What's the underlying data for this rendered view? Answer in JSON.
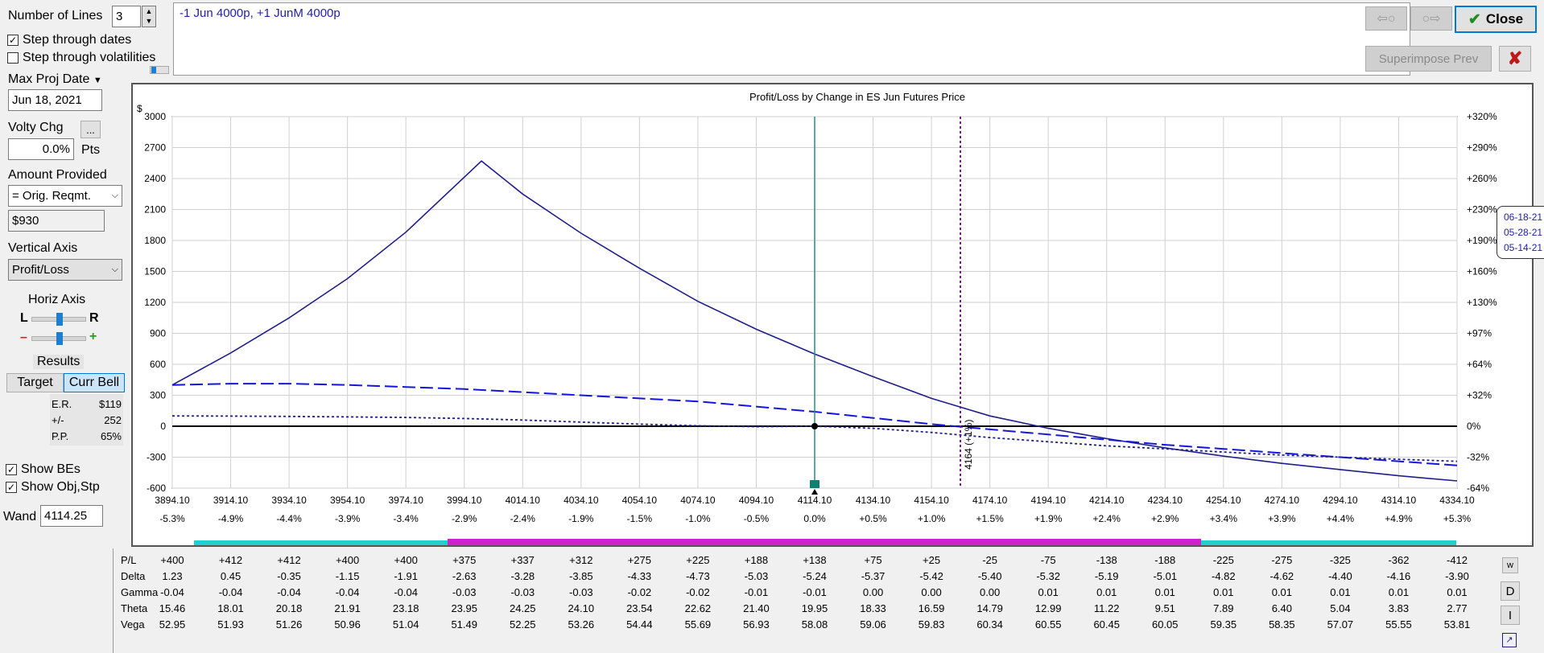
{
  "controls": {
    "number_of_lines_label": "Number of Lines",
    "number_of_lines_value": "3",
    "step_dates_label": "Step through dates",
    "step_vol_label": "Step through volatilities",
    "max_proj_label": "Max Proj Date",
    "max_proj_value": "Jun 18, 2021",
    "volty_label": "Volty Chg",
    "volty_btn": "...",
    "volty_value": "0.0%",
    "volty_unit": "Pts",
    "amount_label": "Amount Provided",
    "amount_combo": "= Orig. Reqmt.",
    "amount_value": "$930",
    "vertical_label": "Vertical Axis",
    "vertical_value": "Profit/Loss",
    "horiz_label": "Horiz Axis",
    "horiz_l": "L",
    "horiz_r": "R",
    "minus": "–",
    "plus": "+",
    "results_label": "Results",
    "target_btn": "Target",
    "currbell_btn": "Curr Bell",
    "er_label": "E.R.",
    "er_value": "$119",
    "pm_label": "+/-",
    "pm_value": "252",
    "pp_label": "P.P.",
    "pp_value": "65%",
    "show_bes": "Show BEs",
    "show_obj": "Show Obj,Stp",
    "wand_label": "Wand",
    "wand_value": "4114.25"
  },
  "editor_text": "-1 Jun 4000p, +1 JunM 4000p",
  "buttons": {
    "close": "Close",
    "superimpose": "Superimpose Prev",
    "back_arrow": "⇦○",
    "fwd_arrow": "○⇨",
    "x": "✘",
    "table_w": "w",
    "table_d": "D",
    "table_i": "I"
  },
  "colors": {
    "line_main": "#1f1f8c",
    "line_dashed": "#1515e0",
    "teal": "#2a8c8c",
    "purple": "#7a1a8c",
    "cyan_bar": "#20d0d0",
    "magenta_bar": "#d020d0"
  },
  "chart_data": {
    "type": "line",
    "title": "Profit/Loss by Change in ES Jun Futures Price",
    "ylabel": "$",
    "ylim": [
      -600,
      3000
    ],
    "y_ticks": [
      3000,
      2700,
      2400,
      2100,
      1800,
      1500,
      1200,
      900,
      600,
      300,
      0,
      -300,
      -600
    ],
    "y_ticks_right": [
      "+320%",
      "+290%",
      "+260%",
      "+230%",
      "+190%",
      "+160%",
      "+130%",
      "+97%",
      "+64%",
      "+32%",
      "0%",
      "-32%",
      "-64%"
    ],
    "xlim": [
      3894.1,
      4334.1
    ],
    "x_ticks": [
      3894.1,
      3914.1,
      3934.1,
      3954.1,
      3974.1,
      3994.1,
      4014.1,
      4034.1,
      4054.1,
      4074.1,
      4094.1,
      4114.1,
      4134.1,
      4154.1,
      4174.1,
      4194.1,
      4214.1,
      4234.1,
      4254.1,
      4274.1,
      4294.1,
      4314.1,
      4334.1
    ],
    "x_tick_labels": [
      "3894.10",
      "3914.10",
      "3934.10",
      "3954.10",
      "3974.10",
      "3994.10",
      "4014.10",
      "4034.10",
      "4054.10",
      "4074.10",
      "4094.10",
      "4114.10",
      "4134.10",
      "4154.10",
      "4174.10",
      "4194.10",
      "4214.10",
      "4234.10",
      "4254.10",
      "4274.10",
      "4294.10",
      "4314.10",
      "4334.10"
    ],
    "x_pct_labels": [
      "-5.3%",
      "-4.9%",
      "-4.4%",
      "-3.9%",
      "-3.4%",
      "-2.9%",
      "-2.4%",
      "-1.9%",
      "-1.5%",
      "-1.0%",
      "-0.5%",
      "0.0%",
      "+0.5%",
      "+1.0%",
      "+1.5%",
      "+1.9%",
      "+2.4%",
      "+2.9%",
      "+3.4%",
      "+3.9%",
      "+4.4%",
      "+4.9%",
      "+5.3%"
    ],
    "current_price": 4114.1,
    "marker_price": 4164,
    "marker_label": "4164 (+1%)",
    "series": [
      {
        "name": "06-18-21",
        "style": "solid",
        "x": [
          3894.1,
          3914.1,
          3934.1,
          3954.1,
          3974.1,
          4000,
          4014.1,
          4034.1,
          4054.1,
          4074.1,
          4094.1,
          4114.1,
          4134.1,
          4154.1,
          4174.1,
          4194.1,
          4214.1,
          4234.1,
          4254.1,
          4274.1,
          4294.1,
          4314.1,
          4334.1
        ],
        "y": [
          400,
          710,
          1050,
          1430,
          1880,
          2570,
          2250,
          1870,
          1530,
          1210,
          940,
          700,
          480,
          270,
          100,
          -20,
          -120,
          -210,
          -290,
          -360,
          -420,
          -480,
          -530
        ]
      },
      {
        "name": "05-28-21 *",
        "style": "dashed",
        "x": [
          3894.1,
          3914.1,
          3934.1,
          3954.1,
          3974.1,
          3994.1,
          4014.1,
          4034.1,
          4054.1,
          4074.1,
          4094.1,
          4114.1,
          4134.1,
          4154.1,
          4174.1,
          4194.1,
          4214.1,
          4234.1,
          4254.1,
          4274.1,
          4294.1,
          4314.1,
          4334.1
        ],
        "y": [
          400,
          412,
          412,
          400,
          380,
          360,
          330,
          300,
          270,
          240,
          190,
          140,
          80,
          20,
          -30,
          -80,
          -130,
          -180,
          -220,
          -260,
          -300,
          -340,
          -380
        ]
      },
      {
        "name": "05-14-21",
        "style": "dotted",
        "x": [
          3894.1,
          3914.1,
          3934.1,
          3954.1,
          3974.1,
          3994.1,
          4014.1,
          4034.1,
          4054.1,
          4074.1,
          4094.1,
          4114.1,
          4134.1,
          4154.1,
          4174.1,
          4194.1,
          4214.1,
          4234.1,
          4254.1,
          4274.1,
          4294.1,
          4314.1,
          4334.1
        ],
        "y": [
          100,
          98,
          95,
          90,
          85,
          75,
          60,
          40,
          20,
          5,
          -5,
          0,
          -20,
          -60,
          -110,
          -150,
          -190,
          -220,
          -250,
          -280,
          -300,
          -320,
          -340
        ]
      }
    ]
  },
  "table": {
    "rows": [
      {
        "label": "P/L",
        "values": [
          "+400",
          "+412",
          "+412",
          "+400",
          "+400",
          "+375",
          "+337",
          "+312",
          "+275",
          "+225",
          "+188",
          "+138",
          "+75",
          "+25",
          "-25",
          "-75",
          "-138",
          "-188",
          "-225",
          "-275",
          "-325",
          "-362",
          "-412"
        ]
      },
      {
        "label": "Delta",
        "values": [
          "1.23",
          "0.45",
          "-0.35",
          "-1.15",
          "-1.91",
          "-2.63",
          "-3.28",
          "-3.85",
          "-4.33",
          "-4.73",
          "-5.03",
          "-5.24",
          "-5.37",
          "-5.42",
          "-5.40",
          "-5.32",
          "-5.19",
          "-5.01",
          "-4.82",
          "-4.62",
          "-4.40",
          "-4.16",
          "-3.90"
        ]
      },
      {
        "label": "Gamma",
        "values": [
          "-0.04",
          "-0.04",
          "-0.04",
          "-0.04",
          "-0.04",
          "-0.03",
          "-0.03",
          "-0.03",
          "-0.02",
          "-0.02",
          "-0.01",
          "-0.01",
          "0.00",
          "0.00",
          "0.00",
          "0.01",
          "0.01",
          "0.01",
          "0.01",
          "0.01",
          "0.01",
          "0.01",
          "0.01"
        ]
      },
      {
        "label": "Theta",
        "values": [
          "15.46",
          "18.01",
          "20.18",
          "21.91",
          "23.18",
          "23.95",
          "24.25",
          "24.10",
          "23.54",
          "22.62",
          "21.40",
          "19.95",
          "18.33",
          "16.59",
          "14.79",
          "12.99",
          "11.22",
          "9.51",
          "7.89",
          "6.40",
          "5.04",
          "3.83",
          "2.77"
        ]
      },
      {
        "label": "Vega",
        "values": [
          "52.95",
          "51.93",
          "51.26",
          "50.96",
          "51.04",
          "51.49",
          "52.25",
          "53.26",
          "54.44",
          "55.69",
          "56.93",
          "58.08",
          "59.06",
          "59.83",
          "60.34",
          "60.55",
          "60.45",
          "60.05",
          "59.35",
          "58.35",
          "57.07",
          "55.55",
          "53.81"
        ]
      }
    ]
  }
}
